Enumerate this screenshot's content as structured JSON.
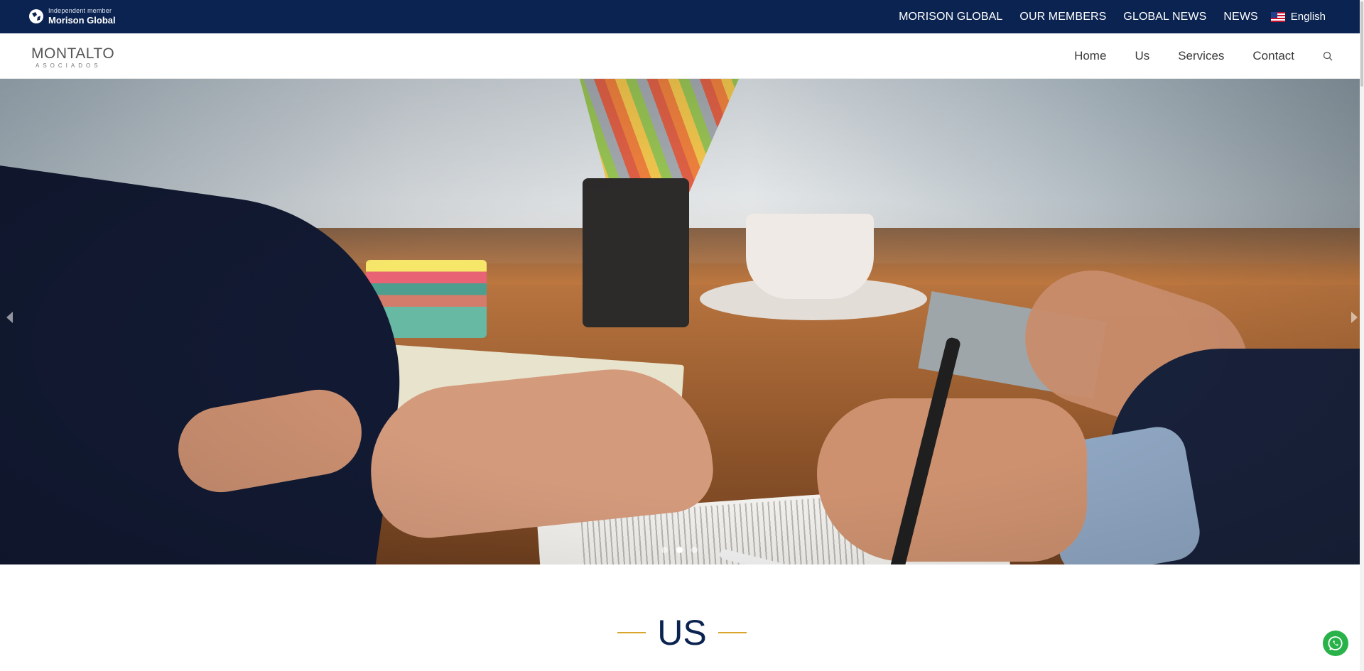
{
  "topbar": {
    "brand_small": "Independent member",
    "brand_big": "Morison Global",
    "links": [
      "MORISON GLOBAL",
      "OUR MEMBERS",
      "GLOBAL NEWS",
      "NEWS"
    ],
    "language": "English"
  },
  "header": {
    "logo_name": "MONTALTO",
    "logo_sub": "ASOCIADOS",
    "nav": [
      "Home",
      "Us",
      "Services",
      "Contact"
    ]
  },
  "hero": {
    "slide_count": 3,
    "active_slide": 2
  },
  "section": {
    "title": "US"
  },
  "colors": {
    "navy": "#0b2350",
    "gold": "#d8a42a",
    "whatsapp": "#29b24a"
  }
}
